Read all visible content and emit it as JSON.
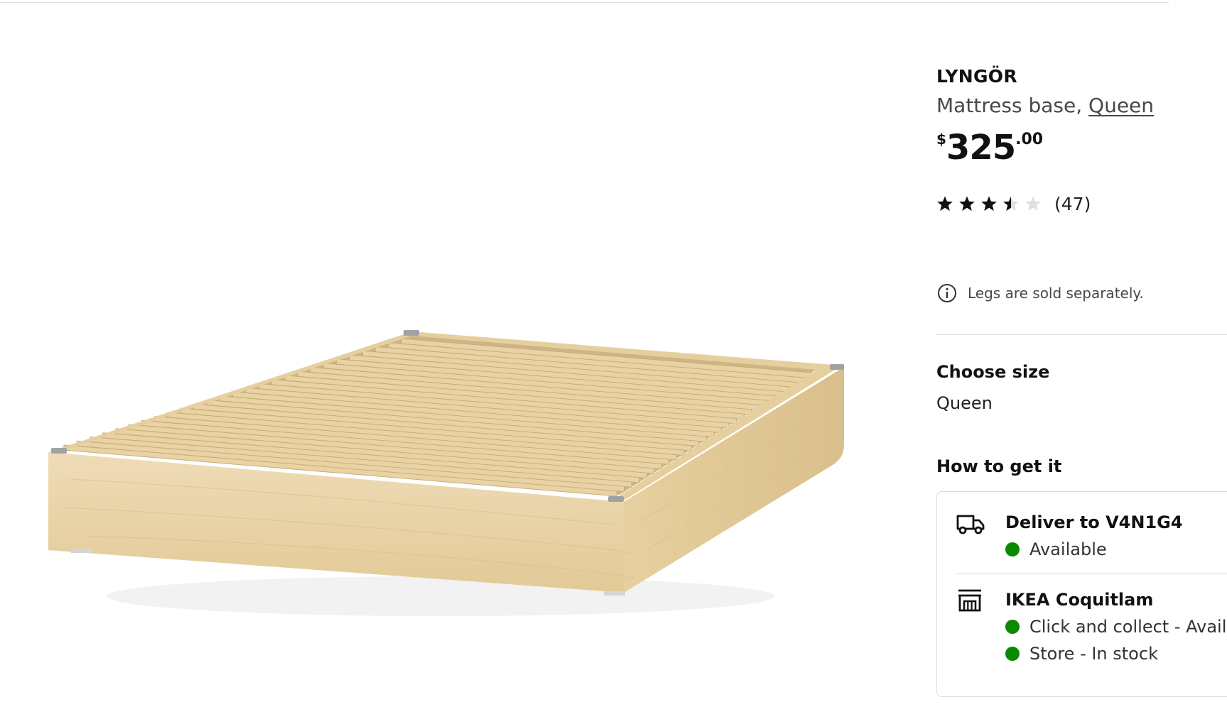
{
  "product": {
    "name": "LYNGÖR",
    "type_prefix": "Mattress base, ",
    "size_link": "Queen",
    "price": {
      "currency": "$",
      "integer": "325",
      "decimal": ".00"
    },
    "rating": {
      "value": 3.5,
      "max": 5,
      "count_label": "(47)"
    },
    "image_icon": "bed-slat-base-illustration"
  },
  "notice": {
    "icon": "info-icon",
    "text": "Legs are sold separately."
  },
  "size_section": {
    "heading": "Choose size",
    "value": "Queen"
  },
  "availability": {
    "heading": "How to get it",
    "options": [
      {
        "icon": "delivery-truck-icon",
        "title": "Deliver to V4N1G4",
        "statuses": [
          "Available"
        ]
      },
      {
        "icon": "store-icon",
        "title": "IKEA Coquitlam",
        "statuses": [
          "Click and collect - Available",
          "Store - In stock"
        ]
      }
    ],
    "status_color": "#0a8a00"
  },
  "colors": {
    "text": "#111111",
    "secondary_text": "#484848",
    "border": "#dcdcdc",
    "star_filled": "#111111",
    "star_empty": "#dfdfdf"
  }
}
